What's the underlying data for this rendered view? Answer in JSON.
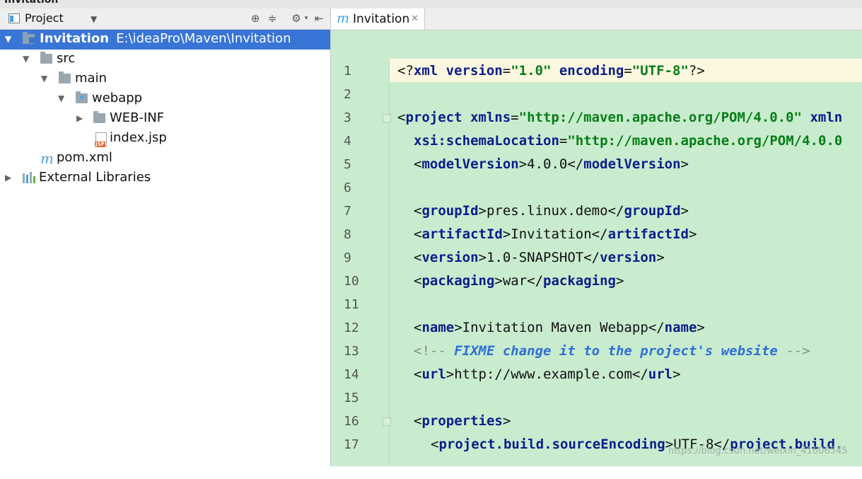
{
  "window": {
    "top_title": "Invitation"
  },
  "project_panel": {
    "title": "Project",
    "tree": [
      {
        "label": "Invitation",
        "path": "E:\\ideaPro\\Maven\\Invitation",
        "icon": "module-folder-icon",
        "expanded": true,
        "selected": true
      },
      {
        "label": "src",
        "icon": "folder-icon",
        "expanded": true
      },
      {
        "label": "main",
        "icon": "folder-icon",
        "expanded": true
      },
      {
        "label": "webapp",
        "icon": "web-folder-icon",
        "expanded": true
      },
      {
        "label": "WEB-INF",
        "icon": "folder-icon",
        "expanded": false
      },
      {
        "label": "index.jsp",
        "icon": "jsp-file-icon"
      },
      {
        "label": "pom.xml",
        "icon": "maven-icon"
      },
      {
        "label": "External Libraries",
        "icon": "libraries-icon",
        "expanded": false
      }
    ]
  },
  "editor": {
    "tab": {
      "label": "Invitation",
      "icon": "maven-icon"
    },
    "line_numbers": [
      "1",
      "2",
      "3",
      "4",
      "5",
      "6",
      "7",
      "8",
      "9",
      "10",
      "11",
      "12",
      "13",
      "14",
      "15",
      "16",
      "17"
    ],
    "lines": {
      "l1": {
        "a": "<?",
        "b": "xml",
        "c": " version",
        "d": "=",
        "e": "\"1.0\"",
        "f": " encoding",
        "g": "=",
        "h": "\"UTF-8\"",
        "i": "?>"
      },
      "l3": {
        "a": "<",
        "b": "project",
        "c": " xmlns",
        "d": "=",
        "e": "\"http://maven.apache.org/POM/4.0.0\"",
        "f": " xmln"
      },
      "l4": {
        "a": "xsi:schemaLocation",
        "b": "=",
        "c": "\"http://maven.apache.org/POM/4.0.0"
      },
      "l5": {
        "a": "<",
        "b": "modelVersion",
        "c": ">4.0.0</",
        "d": "modelVersion",
        "e": ">"
      },
      "l7": {
        "a": "<",
        "b": "groupId",
        "c": ">pres.linux.demo</",
        "d": "groupId",
        "e": ">"
      },
      "l8": {
        "a": "<",
        "b": "artifactId",
        "c": ">Invitation</",
        "d": "artifactId",
        "e": ">"
      },
      "l9": {
        "a": "<",
        "b": "version",
        "c": ">1.0-SNAPSHOT</",
        "d": "version",
        "e": ">"
      },
      "l10": {
        "a": "<",
        "b": "packaging",
        "c": ">war</",
        "d": "packaging",
        "e": ">"
      },
      "l12": {
        "a": "<",
        "b": "name",
        "c": ">Invitation Maven Webapp</",
        "d": "name",
        "e": ">"
      },
      "l13": {
        "a": "<!-- ",
        "b": "FIXME change it to the project's website",
        "c": " -->"
      },
      "l14": {
        "a": "<",
        "b": "url",
        "c": ">http://www.example.com</",
        "d": "url",
        "e": ">"
      },
      "l16": {
        "a": "<",
        "b": "properties",
        "c": ">"
      },
      "l17": {
        "a": "<",
        "b": "project.build.sourceEncoding",
        "c": ">UTF-8</",
        "d": "project.build."
      }
    }
  },
  "watermark": "https://blog.csdn.net/weixin_41606545",
  "colors": {
    "selection": "#3875d7",
    "editor_bg": "#c9ecce",
    "current_line": "#fcf8e0",
    "tag": "#0b1d8c",
    "value": "#067d17",
    "comment_todo": "#2f6fd6"
  }
}
